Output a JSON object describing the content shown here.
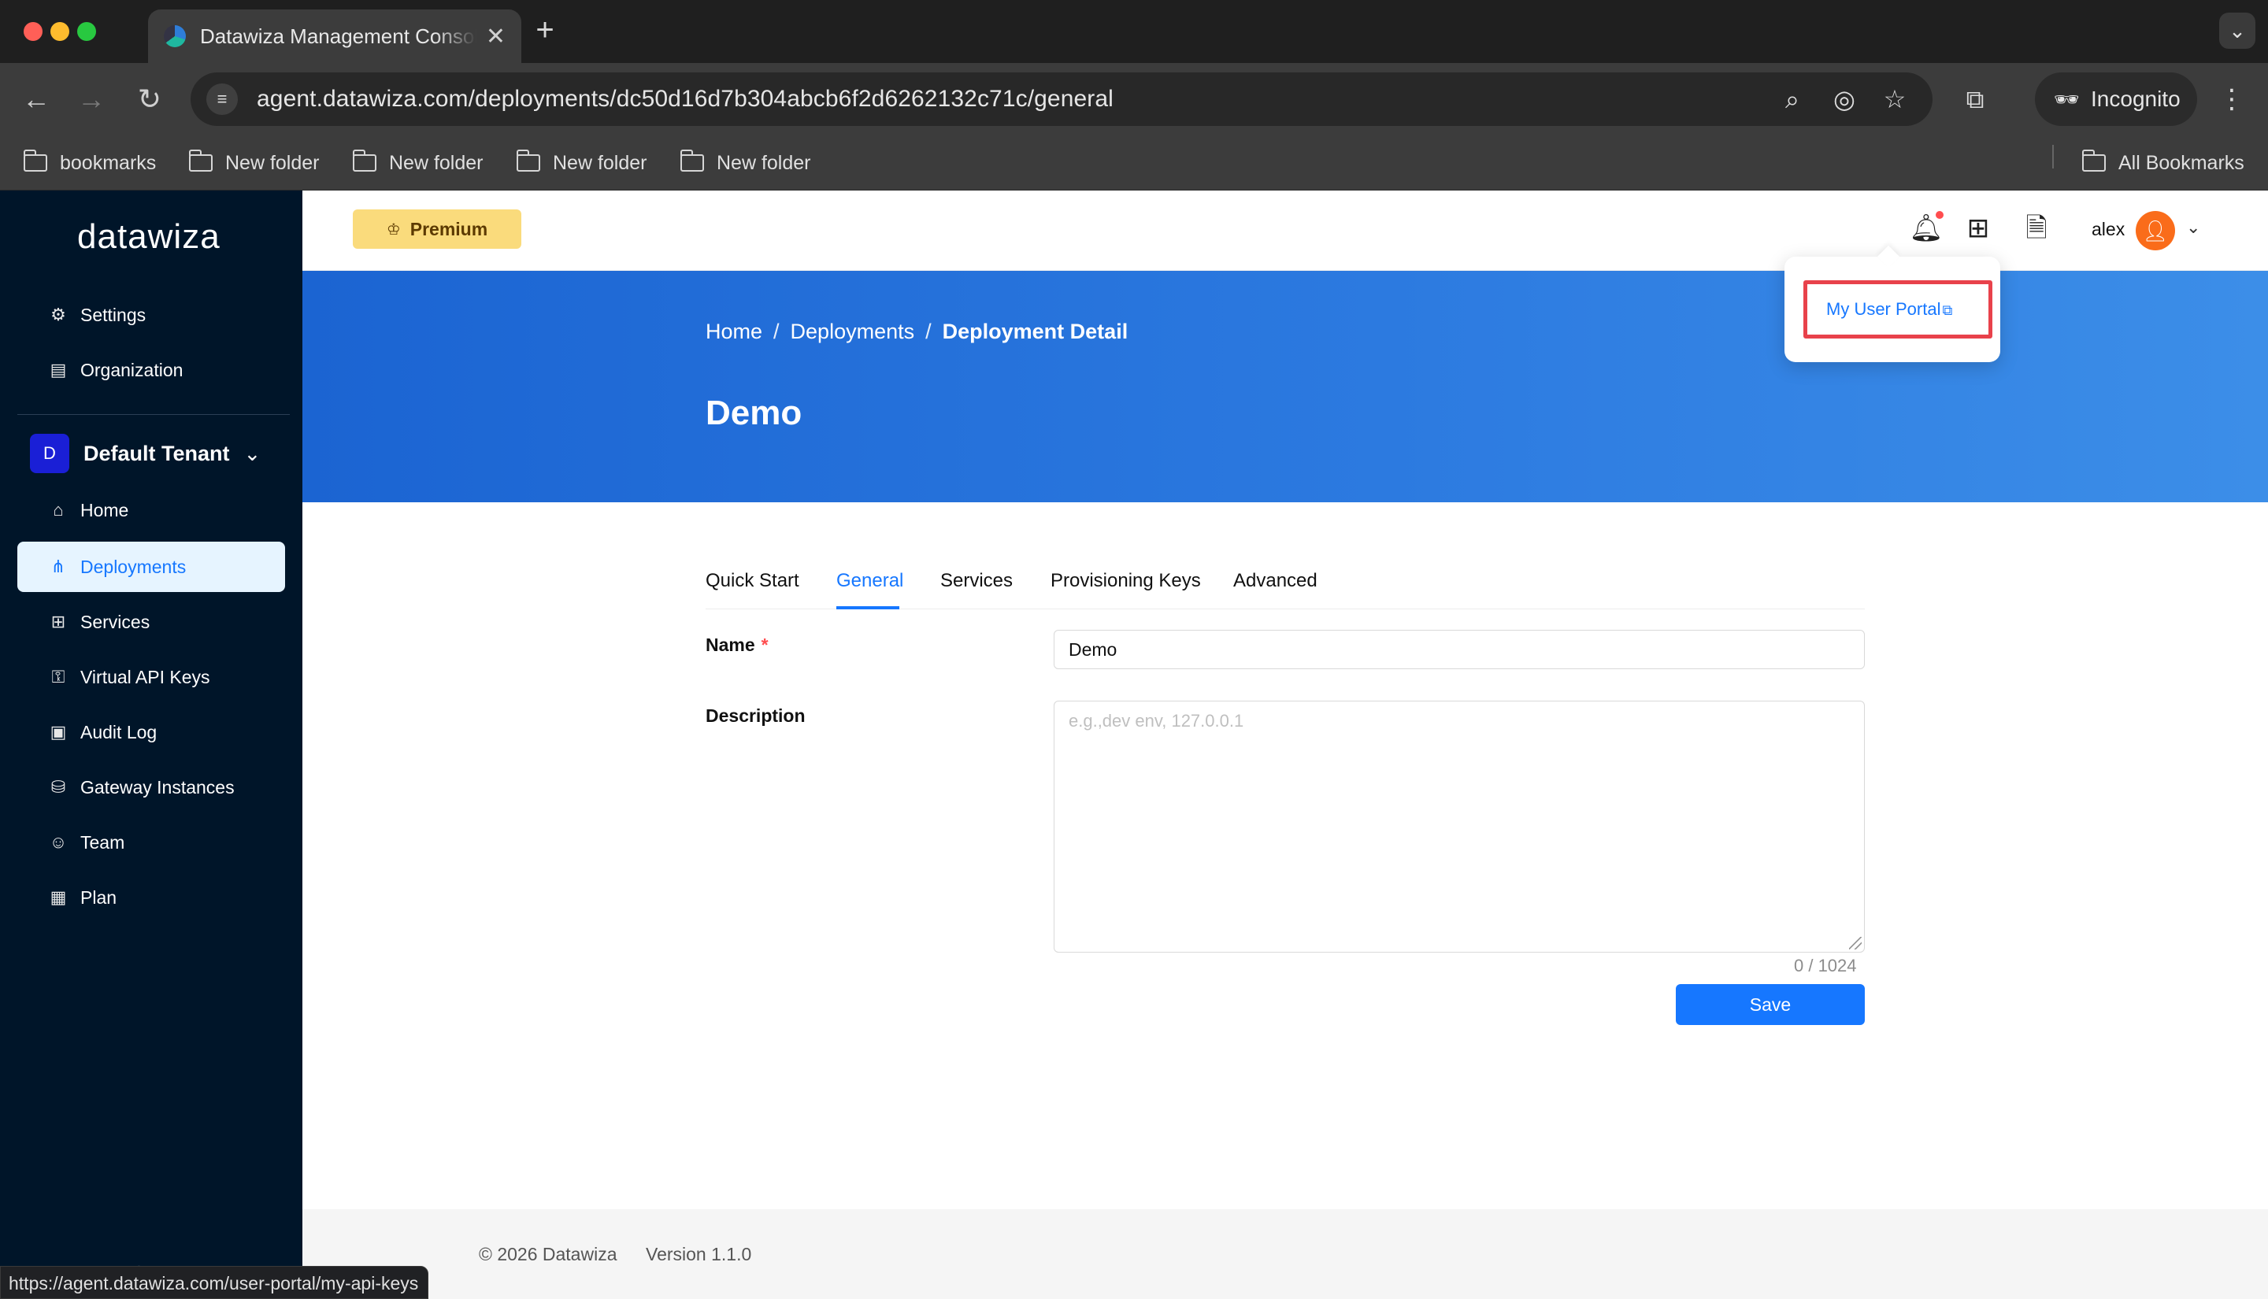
{
  "browser": {
    "tab_title": "Datawiza Management Console",
    "tab_close": "✕",
    "new_tab": "+",
    "url": "agent.datawiza.com/deployments/dc50d16d7b304abcb6f2d6262132c71c/general",
    "incognito_label": "Incognito",
    "bookmarks": [
      "bookmarks",
      "New folder",
      "New folder",
      "New folder",
      "New folder"
    ],
    "all_bookmarks": "All Bookmarks",
    "status_url": "https://agent.datawiza.com/user-portal/my-api-keys"
  },
  "sidebar": {
    "logo": "datawiza",
    "top_items": [
      {
        "label": "Settings",
        "icon": "gear-icon"
      },
      {
        "label": "Organization",
        "icon": "building-icon"
      }
    ],
    "tenant": {
      "badge": "D",
      "name": "Default Tenant"
    },
    "items": [
      {
        "label": "Home",
        "icon": "home-icon"
      },
      {
        "label": "Deployments",
        "icon": "deployment-icon",
        "active": true
      },
      {
        "label": "Services",
        "icon": "grid-icon"
      },
      {
        "label": "Virtual API Keys",
        "icon": "key-icon"
      },
      {
        "label": "Audit Log",
        "icon": "audit-icon"
      },
      {
        "label": "Gateway Instances",
        "icon": "gateway-icon"
      },
      {
        "label": "Team",
        "icon": "team-icon"
      },
      {
        "label": "Plan",
        "icon": "plan-icon"
      }
    ]
  },
  "header": {
    "premium_label": "Premium",
    "user_name": "alex"
  },
  "dropdown": {
    "portal_link": "My User Portal",
    "highlight_color": "#e8424b"
  },
  "hero": {
    "breadcrumb": [
      "Home",
      "Deployments",
      "Deployment Detail"
    ],
    "separator": "/",
    "title": "Demo"
  },
  "tabs": [
    "Quick Start",
    "General",
    "Services",
    "Provisioning Keys",
    "Advanced"
  ],
  "active_tab": "General",
  "form": {
    "name_label": "Name",
    "required_mark": "*",
    "name_value": "Demo",
    "description_label": "Description",
    "description_placeholder": "e.g.,dev env, 127.0.0.1",
    "char_count": "0 / 1024",
    "save_label": "Save"
  },
  "footer": {
    "copyright": "© 2026 Datawiza",
    "version": "Version 1.1.0"
  },
  "colors": {
    "sidebar_bg": "#001529",
    "accent": "#1677ff",
    "hero_blue": "#2c7ae0",
    "premium_bg": "#fadb7c"
  }
}
